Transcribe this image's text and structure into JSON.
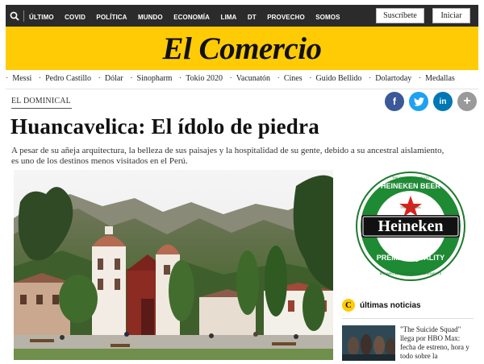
{
  "topbar": {
    "nav": [
      "ÚLTIMO",
      "COVID",
      "POLÍTICA",
      "MUNDO",
      "ECONOMÍA",
      "LIMA",
      "DT",
      "PROVECHO",
      "SOMOS"
    ],
    "subscribe_label": "Suscríbete",
    "login_label": "Iniciar"
  },
  "masthead": {
    "logo": "El Comercio"
  },
  "tags": [
    "Messi",
    "Pedro Castillo",
    "Dólar",
    "Sinopharm",
    "Tokio 2020",
    "Vacunatón",
    "Cines",
    "Guido Bellido",
    "Dolartoday",
    "Medallas"
  ],
  "article": {
    "section": "EL DOMINICAL",
    "title": "Huancavelica: El ídolo de piedra",
    "lead": "A pesar de su añeja arquitectura, la belleza de sus paisajes y la hospitalidad de su gente, debido a su ancestral aislamiento, es uno de los destinos menos visitados en el Perú."
  },
  "ad": {
    "top_text": "THE ORIGINAL QUALITY",
    "beer_text": "HEINEKEN BEER",
    "brand": "Heineken",
    "bottom_text": "PREMIUM QUALITY",
    "tiny_text": "BREWED WITH NATURAL INGREDIENTS",
    "trade_mark": "TRADE MARK"
  },
  "sidebar": {
    "logo_letter": "C",
    "heading": "últimas noticias",
    "item_text": "\"The Suicide Squad\" llega por HBO Max: fecha de estreno, hora y todo sobre la"
  },
  "colors": {
    "brand_yellow": "#ffcb05",
    "topbar": "#2b2b2b"
  },
  "icons": {
    "search": "search-icon",
    "facebook": "facebook-icon",
    "twitter": "twitter-icon",
    "linkedin": "linkedin-icon",
    "more": "plus-icon"
  }
}
